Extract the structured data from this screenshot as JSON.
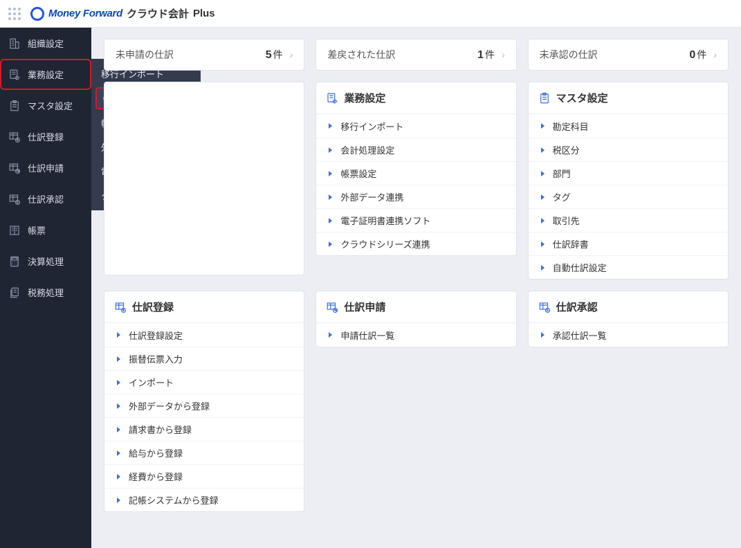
{
  "header": {
    "brand": "Money Forward",
    "product": "クラウド会計",
    "suffix": "Plus"
  },
  "sidebar": {
    "items": [
      {
        "label": "組織設定",
        "icon": "building"
      },
      {
        "label": "業務設定",
        "icon": "doc-gear",
        "highlight": true,
        "submenu": true
      },
      {
        "label": "マスタ設定",
        "icon": "clipboard"
      },
      {
        "label": "仕訳登録",
        "icon": "table-plus"
      },
      {
        "label": "仕訳申請",
        "icon": "table-arrow"
      },
      {
        "label": "仕訳承認",
        "icon": "table-check"
      },
      {
        "label": "帳票",
        "icon": "book"
      },
      {
        "label": "決算処理",
        "icon": "calculator"
      },
      {
        "label": "税務処理",
        "icon": "doc-stack"
      }
    ]
  },
  "flyout": {
    "items": [
      {
        "label": "移行インポート"
      },
      {
        "label": "会計処理設定",
        "highlight": true
      },
      {
        "label": "帳票設定"
      },
      {
        "label": "外部データ連携"
      },
      {
        "label": "電子証明書連携ソフト"
      },
      {
        "label": "クラウドシリーズ連携"
      }
    ]
  },
  "stats": [
    {
      "label": "未申請の仕訳",
      "count": "5",
      "unit": "件"
    },
    {
      "label": "差戻された仕訳",
      "count": "1",
      "unit": "件"
    },
    {
      "label": "未承認の仕訳",
      "count": "0",
      "unit": "件"
    }
  ],
  "sections_row1": [
    {
      "title": "",
      "hidden_by_flyout": true,
      "items": []
    },
    {
      "title": "業務設定",
      "icon": "doc-gear",
      "items": [
        "移行インポート",
        "会計処理設定",
        "帳票設定",
        "外部データ連携",
        "電子証明書連携ソフト",
        "クラウドシリーズ連携"
      ]
    },
    {
      "title": "マスタ設定",
      "icon": "clipboard",
      "items": [
        "勘定科目",
        "税区分",
        "部門",
        "タグ",
        "取引先",
        "仕訳辞書",
        "自動仕訳設定"
      ]
    }
  ],
  "sections_row2": [
    {
      "title": "仕訳登録",
      "icon": "table-plus",
      "items": [
        "仕訳登録設定",
        "振替伝票入力",
        "インポート",
        "外部データから登録",
        "請求書から登録",
        "給与から登録",
        "経費から登録",
        "記帳システムから登録"
      ]
    },
    {
      "title": "仕訳申請",
      "icon": "table-arrow",
      "items": [
        "申請仕訳一覧"
      ]
    },
    {
      "title": "仕訳承認",
      "icon": "table-check",
      "items": [
        "承認仕訳一覧"
      ]
    }
  ]
}
